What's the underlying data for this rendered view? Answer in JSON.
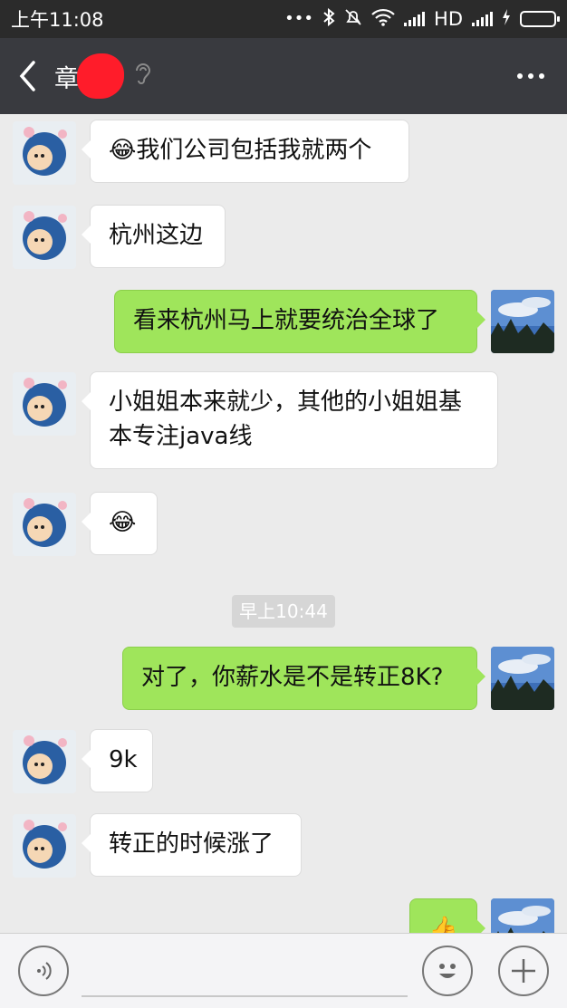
{
  "status_bar": {
    "time": "上午11:08",
    "dots": "•••",
    "network": "HD",
    "bluetooth_icon": "bluetooth-icon",
    "mute_icon": "bell-off-icon",
    "wifi_icon": "wifi-icon",
    "charging_icon": "lightning-icon"
  },
  "nav": {
    "title": "章",
    "title_suffix": "",
    "back_icon": "chevron-left-icon",
    "ear_icon": "ear-icon",
    "more_icon": "more-dots-icon"
  },
  "messages": [
    {
      "dir": "in",
      "emoji": "😂",
      "text": "我们公司包括我就两个"
    },
    {
      "dir": "in",
      "text": "杭州这边"
    },
    {
      "dir": "out",
      "text": "看来杭州马上就要统治全球了"
    },
    {
      "dir": "in",
      "text": "小姐姐本来就少，其他的小姐姐基本专注java线"
    },
    {
      "dir": "in",
      "emoji": "😂",
      "text": ""
    },
    {
      "dir": "out",
      "text": "对了，你薪水是不是转正8K?"
    },
    {
      "dir": "in",
      "text": "9k"
    },
    {
      "dir": "in",
      "text": "转正的时候涨了"
    },
    {
      "dir": "out",
      "text": "👍"
    }
  ],
  "timestamp": "早上10:44",
  "input_bar": {
    "voice_icon": "voice-icon",
    "emoji_icon": "smiley-icon",
    "plus_icon": "plus-icon",
    "placeholder": ""
  },
  "colors": {
    "outgoing_bubble": "#9fe55b",
    "incoming_bubble": "#ffffff",
    "nav_bg": "#393a3f",
    "chat_bg": "#ebebeb"
  }
}
